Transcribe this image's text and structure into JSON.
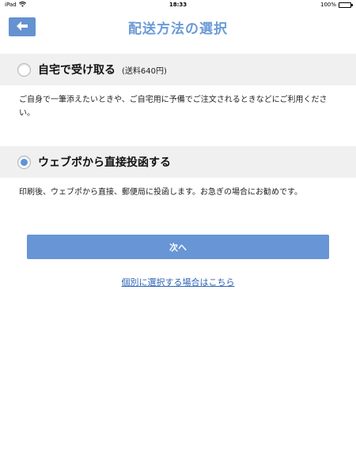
{
  "status_bar": {
    "carrier": "iPad",
    "wifi_icon": "wifi-icon",
    "time": "18:33",
    "battery_percent": "100%",
    "battery_level": 1.0
  },
  "nav": {
    "back_icon": "arrow-left-icon",
    "title": "配送方法の選択"
  },
  "options": [
    {
      "label": "自宅で受け取る",
      "note": "(送料640円)",
      "description": "ご自身で一筆添えたいときや、ご自宅用に予備でご注文されるときなどにご利用ください。",
      "selected": false
    },
    {
      "label": "ウェブポから直接投函する",
      "note": "",
      "description": "印刷後、ウェブポから直接、郵便局に投函します。お急ぎの場合にお勧めです。",
      "selected": true
    }
  ],
  "next_button": {
    "label": "次へ"
  },
  "individual_link": {
    "label": "個別に選択する場合はこちら"
  },
  "colors": {
    "accent": "#6795d5",
    "title": "#6b9bd6",
    "link": "#2f63b6",
    "option_bg": "#f0f0f0"
  }
}
